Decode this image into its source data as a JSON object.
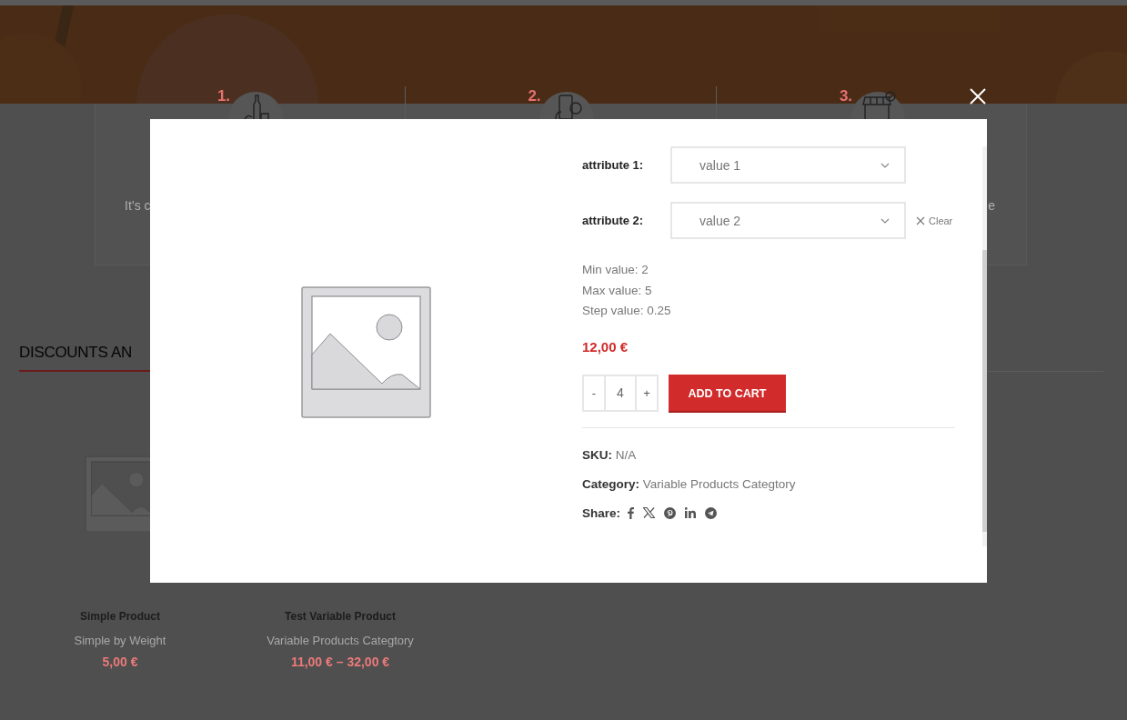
{
  "steps": [
    {
      "number": "1.",
      "kind": "bottle",
      "text": "It’s c"
    },
    {
      "number": "2.",
      "kind": "phone"
    },
    {
      "number": "3.",
      "kind": "shop",
      "text": "e"
    }
  ],
  "section_title": "DISCOUNTS AN",
  "products": [
    {
      "name": "Simple Product",
      "category": "Simple by Weight",
      "price": "5,00 €"
    },
    {
      "name": "Test Variable Product",
      "category": "Variable Products Categtory",
      "price": "11,00 € – 32,00 €"
    }
  ],
  "quick_view": {
    "attributes": [
      {
        "label": "attribute 1:",
        "value": "value 1"
      },
      {
        "label": "attribute 2:",
        "value": "value 2",
        "clear": "Clear"
      }
    ],
    "limits": [
      "Min value: 2",
      "Max value: 5",
      "Step value: 0.25"
    ],
    "price": "12,00 €",
    "quantity": {
      "minus": "-",
      "value": "4",
      "plus": "+"
    },
    "add_to_cart": "ADD TO CART",
    "meta": [
      {
        "label": "SKU:",
        "value": "N/A"
      },
      {
        "label": "Category:",
        "value": "Variable Products Categtory"
      }
    ],
    "share_label": "Share:",
    "share_networks": [
      {
        "kind": "facebook"
      },
      {
        "kind": "x"
      },
      {
        "kind": "pinterest"
      },
      {
        "kind": "linkedin"
      },
      {
        "kind": "telegram"
      }
    ]
  }
}
